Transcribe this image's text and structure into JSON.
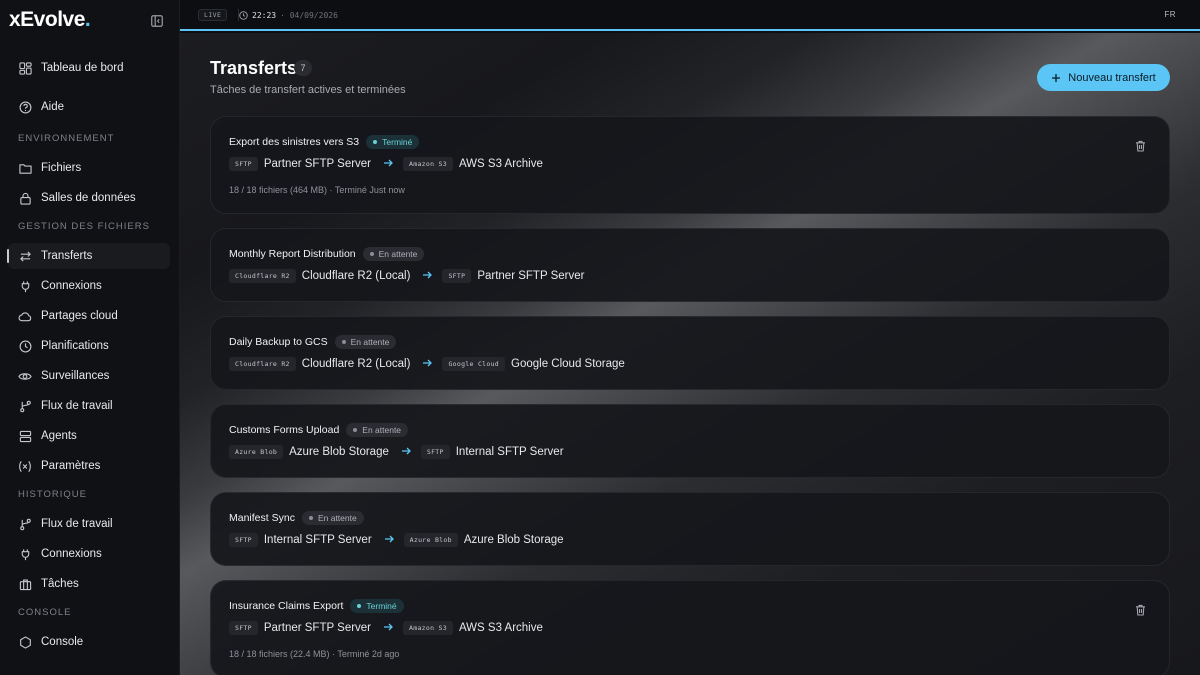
{
  "app": {
    "logo_main": "xEvolve",
    "logo_dot": "."
  },
  "sidebar": {
    "items_top": [
      {
        "label": "Tableau de bord",
        "icon": "dashboard-icon"
      },
      {
        "label": "Aide",
        "icon": "help-icon"
      }
    ],
    "sections": [
      {
        "label": "ENVIRONNEMENT",
        "items": [
          {
            "label": "Fichiers",
            "icon": "folder-icon"
          },
          {
            "label": "Salles de données",
            "icon": "lock-icon"
          }
        ]
      },
      {
        "label": "GESTION DES FICHIERS",
        "items": [
          {
            "label": "Transferts",
            "icon": "transfer-icon",
            "active": true
          },
          {
            "label": "Connexions",
            "icon": "plug-icon"
          },
          {
            "label": "Partages cloud",
            "icon": "cloud-icon"
          },
          {
            "label": "Planifications",
            "icon": "clock-icon"
          },
          {
            "label": "Surveillances",
            "icon": "eye-icon"
          },
          {
            "label": "Flux de travail",
            "icon": "workflow-icon"
          },
          {
            "label": "Agents",
            "icon": "server-icon"
          },
          {
            "label": "Paramètres",
            "icon": "variable-icon"
          }
        ]
      },
      {
        "label": "HISTORIQUE",
        "items": [
          {
            "label": "Flux de travail",
            "icon": "workflow-icon"
          },
          {
            "label": "Connexions",
            "icon": "plug-icon"
          },
          {
            "label": "Tâches",
            "icon": "briefcase-icon"
          }
        ]
      },
      {
        "label": "CONSOLE",
        "items": [
          {
            "label": "Console",
            "icon": "hexagon-icon"
          }
        ]
      }
    ]
  },
  "topbar": {
    "live": "LIVE",
    "time": "22:23",
    "date": "· 04/09/2026",
    "lang": "FR"
  },
  "main": {
    "title": "Transferts",
    "count": "7",
    "subtitle": "Tâches de transfert actives et terminées",
    "new_button": "Nouveau transfert"
  },
  "transfers": [
    {
      "title": "Export des sinistres vers S3",
      "status": "Terminé",
      "status_kind": "done",
      "src_tag": "SFTP",
      "src": "Partner SFTP Server",
      "dst_tag": "Amazon S3",
      "dst": "AWS S3 Archive",
      "meta": "18 / 18 fichiers (464 MB) · Terminé Just now",
      "deletable": true
    },
    {
      "title": "Monthly Report Distribution",
      "status": "En attente",
      "status_kind": "pending",
      "src_tag": "Cloudflare R2",
      "src": "Cloudflare R2 (Local)",
      "dst_tag": "SFTP",
      "dst": "Partner SFTP Server",
      "meta": "",
      "deletable": false
    },
    {
      "title": "Daily Backup to GCS",
      "status": "En attente",
      "status_kind": "pending",
      "src_tag": "Cloudflare R2",
      "src": "Cloudflare R2 (Local)",
      "dst_tag": "Google Cloud",
      "dst": "Google Cloud Storage",
      "meta": "",
      "deletable": false
    },
    {
      "title": "Customs Forms Upload",
      "status": "En attente",
      "status_kind": "pending",
      "src_tag": "Azure Blob",
      "src": "Azure Blob Storage",
      "dst_tag": "SFTP",
      "dst": "Internal SFTP Server",
      "meta": "",
      "deletable": false
    },
    {
      "title": "Manifest Sync",
      "status": "En attente",
      "status_kind": "pending",
      "src_tag": "SFTP",
      "src": "Internal SFTP Server",
      "dst_tag": "Azure Blob",
      "dst": "Azure Blob Storage",
      "meta": "",
      "deletable": false
    },
    {
      "title": "Insurance Claims Export",
      "status": "Terminé",
      "status_kind": "done",
      "src_tag": "SFTP",
      "src": "Partner SFTP Server",
      "dst_tag": "Amazon S3",
      "dst": "AWS S3 Archive",
      "meta": "18 / 18 fichiers (22.4 MB) · Terminé 2d ago",
      "deletable": true
    }
  ],
  "colors": {
    "accent": "#5bc6f5",
    "done": "#68d0d8"
  }
}
